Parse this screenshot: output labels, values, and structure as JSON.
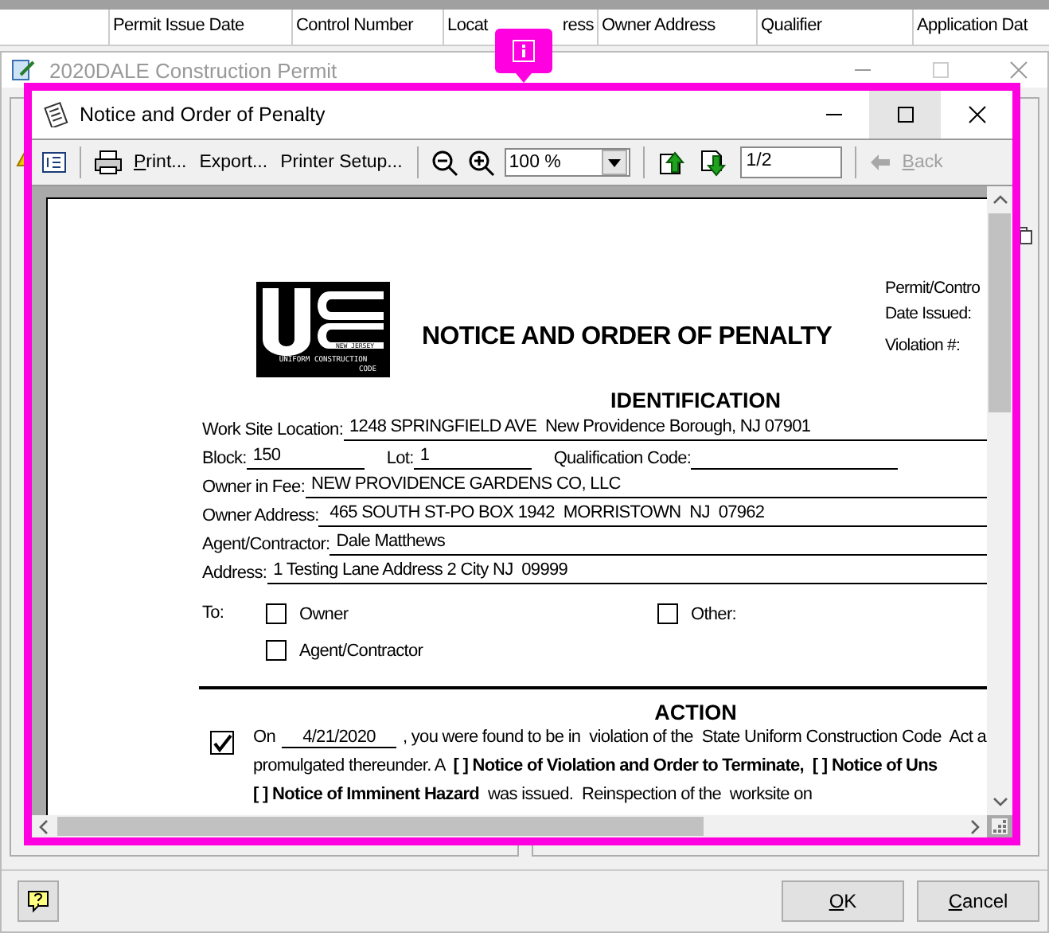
{
  "grid_header": {
    "columns": [
      {
        "label": "Permit Issue Date"
      },
      {
        "label": "Control Number"
      },
      {
        "label": "Locat",
        "label_tail": "ress"
      },
      {
        "label": "Owner Address"
      },
      {
        "label": "Qualifier"
      },
      {
        "label": "Application Dat"
      }
    ]
  },
  "permit_window": {
    "title": "2020DALE Construction Permit",
    "active": false,
    "buttons": [
      {
        "mnemonic": "O",
        "rest": "K"
      },
      {
        "mnemonic": "C",
        "rest": "ancel"
      }
    ]
  },
  "dialog": {
    "title": "Notice and Order of Penalty",
    "active": true,
    "toolbar": {
      "print": {
        "mnemonic": "P",
        "rest": "rint..."
      },
      "export": {
        "label": "Export..."
      },
      "printer_setup": {
        "label": "Printer Setup..."
      },
      "zoom": "100 %",
      "page": "1/2",
      "back": {
        "mnemonic": "B",
        "rest": "ack",
        "disabled": true
      }
    },
    "document": {
      "logo_caption": [
        "NEW JERSEY",
        "UNIFORM CONSTRUCTION",
        "CODE"
      ],
      "title": "NOTICE AND ORDER OF PENALTY",
      "header_right": [
        "Permit/Contro",
        "Date Issued:",
        "Violation #:"
      ],
      "section": "IDENTIFICATION",
      "field_rows": [
        [
          {
            "label": "Work Site Location:",
            "value": "1248 SPRINGFIELD AVE  New Providence Borough, NJ 07901"
          }
        ],
        [
          {
            "label": "Block:",
            "value": "150"
          },
          {
            "label": "Lot:",
            "value": "1"
          },
          {
            "label": "Qualification Code:"
          }
        ],
        [
          {
            "label": "Owner in Fee:",
            "value": "NEW PROVIDENCE GARDENS CO, LLC"
          }
        ],
        [
          {
            "label": "Owner Address:",
            "value": " 465 SOUTH ST-PO BOX 1942  MORRISTOWN  NJ  07962"
          }
        ],
        [
          {
            "label": "Agent/Contractor:",
            "value": "Dale Matthews"
          }
        ],
        [
          {
            "label": "Address:",
            "value": "1 Testing Lane Address 2 City NJ  09999"
          }
        ]
      ],
      "to": {
        "label": "To:",
        "options": [
          {
            "label": "Owner",
            "checked": false
          },
          {
            "label": "Other:",
            "checked": false
          },
          {
            "label": "Agent/Contractor",
            "checked": false
          }
        ]
      },
      "action": {
        "heading": "ACTION",
        "checked": true,
        "on": "On",
        "date": "4/21/2020",
        "first_line_rest": ", you were found to be in  violation of the  State Uniform Construction Code  Act a",
        "lines": [
          "promulgated thereunder. A  **[ ] Notice of Violation and Order to Terminate,**  **[ ] Notice of Uns**",
          "**[ ] Notice of Imminent Hazard**  was issued.  Reinspection of the  worksite on"
        ]
      }
    }
  }
}
